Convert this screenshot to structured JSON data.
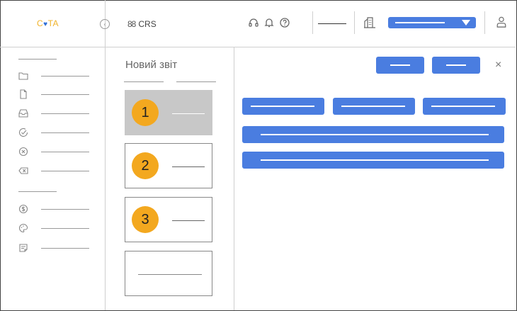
{
  "header": {
    "logo_text_left": "C",
    "logo_heart": "♥",
    "logo_text_right": "TA",
    "collapse_icon": "chevron-left-icon",
    "app_name": "CRS",
    "app_icon": "grid-icon",
    "icons": [
      "headset-icon",
      "bell-icon",
      "help-icon",
      "building-icon",
      "user-icon"
    ],
    "accent_color": "#4a7de0"
  },
  "sidebar": {
    "items": [
      {
        "icon": "folder-icon"
      },
      {
        "icon": "document-icon"
      },
      {
        "icon": "inbox-icon"
      },
      {
        "icon": "check-circle-icon"
      },
      {
        "icon": "x-circle-icon"
      },
      {
        "icon": "delete-icon"
      },
      {
        "icon": "dollar-icon"
      },
      {
        "icon": "palette-icon"
      },
      {
        "icon": "notes-icon"
      }
    ]
  },
  "report": {
    "title": "Новий звіт",
    "steps": [
      {
        "number": "1",
        "active": true
      },
      {
        "number": "2",
        "active": false
      },
      {
        "number": "3",
        "active": false
      },
      {
        "number": "",
        "active": false
      }
    ]
  },
  "main": {
    "close_label": "×",
    "step_color": "#f3a81f"
  }
}
